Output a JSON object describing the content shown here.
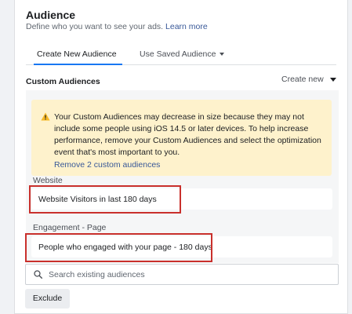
{
  "audience": {
    "title": "Audience",
    "subtitle": "Define who you want to see your ads.",
    "learn_more": "Learn more"
  },
  "tabs": [
    {
      "label": "Create New Audience",
      "active": true
    },
    {
      "label": "Use Saved Audience",
      "active": false
    }
  ],
  "custom_audiences": {
    "label": "Custom Audiences",
    "create_new": "Create new"
  },
  "warning": {
    "icon": "warning-triangle-icon",
    "text": "Your Custom Audiences may decrease in size because they may not include some people using iOS 14.5 or later devices. To help increase performance, remove your Custom Audiences and select the optimization event that's most important to you.",
    "link": "Remove 2 custom audiences"
  },
  "sections": [
    {
      "label": "Website",
      "value": "Website Visitors in last 180 days"
    },
    {
      "label": "Engagement - Page",
      "value": "People who engaged with your page - 180 days"
    }
  ],
  "search": {
    "placeholder": "Search existing audiences"
  },
  "exclude_label": "Exclude",
  "colors": {
    "accent": "#1877f2",
    "link": "#385898",
    "warning_bg": "#fef2cc",
    "highlight": "#c9302c"
  }
}
